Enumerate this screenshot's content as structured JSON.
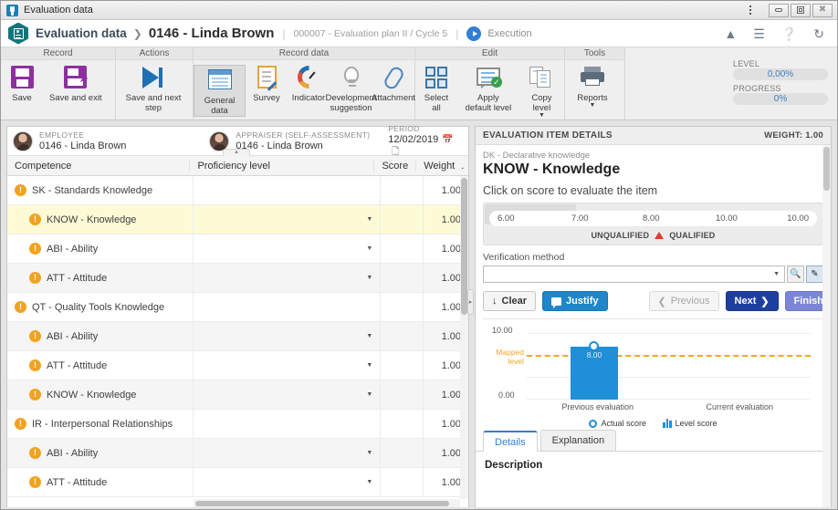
{
  "window": {
    "title": "Evaluation data",
    "icon": "app-icon",
    "buttons": {
      "menu": "⋮",
      "minimize": "minimize",
      "maximize": "maximize",
      "close": "close"
    }
  },
  "breadcrumb": {
    "icon": "evaluation-card-icon",
    "root": "Evaluation data",
    "separator": "❯",
    "current": "0146 - Linda Brown",
    "plan": "000007 - Evaluation plan II / Cycle 5",
    "status": "Execution",
    "tools": [
      "collapse-icon",
      "list-icon",
      "help-icon",
      "refresh-icon"
    ]
  },
  "ribbon": {
    "groups": [
      {
        "title": "Record",
        "buttons": [
          {
            "label": "Save",
            "icon": "save-icon"
          },
          {
            "label": "Save and exit",
            "icon": "save-and-exit-icon"
          }
        ]
      },
      {
        "title": "Actions",
        "buttons": [
          {
            "label": "Save and next step",
            "icon": "next-step-icon"
          }
        ]
      },
      {
        "title": "Record data",
        "buttons": [
          {
            "label": "General data",
            "icon": "general-data-icon",
            "selected": true
          },
          {
            "label": "Survey",
            "icon": "survey-icon"
          },
          {
            "label": "Indicator",
            "icon": "indicator-icon"
          },
          {
            "label": "Development suggestion",
            "icon": "bulb-icon"
          },
          {
            "label": "Attachment",
            "icon": "paperclip-icon"
          }
        ]
      },
      {
        "title": "Edit",
        "buttons": [
          {
            "label": "Select all",
            "icon": "select-all-icon"
          },
          {
            "label": "Apply default level",
            "icon": "apply-default-icon"
          },
          {
            "label": "Copy level",
            "icon": "copy-level-icon",
            "caret": "▼"
          }
        ]
      },
      {
        "title": "Tools",
        "buttons": [
          {
            "label": "Reports",
            "icon": "printer-icon",
            "caret": "▼"
          }
        ]
      }
    ],
    "status": {
      "level_label": "LEVEL",
      "level_value": "0,00%",
      "progress_label": "PROGRESS",
      "progress_value": "0%"
    }
  },
  "persons": {
    "employee_label": "EMPLOYEE",
    "employee_value": "0146 - Linda Brown",
    "appraiser_label": "APPRAISER (SELF-ASSESSMENT)",
    "appraiser_value": "0146 - Linda Brown",
    "period_label": "PERIOD",
    "period_value": "12/02/2019",
    "period_icons": [
      "calendar-icon",
      "note-icon"
    ]
  },
  "table": {
    "columns": [
      "Competence",
      "Proficiency level",
      "Score",
      "Weight",
      "."
    ],
    "rows": [
      {
        "competence": "SK - Standards Knowledge",
        "level": "",
        "score": "",
        "weight": "1.00",
        "indent": 1,
        "group": true,
        "selected": false,
        "alt": false,
        "dropdown": false
      },
      {
        "competence": "KNOW - Knowledge",
        "level": "",
        "score": "",
        "weight": "1.00",
        "indent": 2,
        "group": false,
        "selected": true,
        "alt": false,
        "dropdown": true
      },
      {
        "competence": "ABI - Ability",
        "level": "",
        "score": "",
        "weight": "1.00",
        "indent": 2,
        "group": false,
        "selected": false,
        "alt": false,
        "dropdown": true
      },
      {
        "competence": "ATT - Attitude",
        "level": "",
        "score": "",
        "weight": "1.00",
        "indent": 2,
        "group": false,
        "selected": false,
        "alt": true,
        "dropdown": true
      },
      {
        "competence": "QT - Quality Tools Knowledge",
        "level": "",
        "score": "",
        "weight": "1.00",
        "indent": 1,
        "group": true,
        "selected": false,
        "alt": false,
        "dropdown": false
      },
      {
        "competence": "ABI - Ability",
        "level": "",
        "score": "",
        "weight": "1.00",
        "indent": 2,
        "group": false,
        "selected": false,
        "alt": true,
        "dropdown": true
      },
      {
        "competence": "ATT - Attitude",
        "level": "",
        "score": "",
        "weight": "1.00",
        "indent": 2,
        "group": false,
        "selected": false,
        "alt": false,
        "dropdown": true
      },
      {
        "competence": "KNOW - Knowledge",
        "level": "",
        "score": "",
        "weight": "1.00",
        "indent": 2,
        "group": false,
        "selected": false,
        "alt": true,
        "dropdown": true
      },
      {
        "competence": "IR - Interpersonal Relationships",
        "level": "",
        "score": "",
        "weight": "1.00",
        "indent": 1,
        "group": true,
        "selected": false,
        "alt": false,
        "dropdown": false
      },
      {
        "competence": "ABI - Ability",
        "level": "",
        "score": "",
        "weight": "1.00",
        "indent": 2,
        "group": false,
        "selected": false,
        "alt": true,
        "dropdown": true
      },
      {
        "competence": "ATT - Attitude",
        "level": "",
        "score": "",
        "weight": "1.00",
        "indent": 2,
        "group": false,
        "selected": false,
        "alt": false,
        "dropdown": true
      }
    ]
  },
  "details": {
    "header": "EVALUATION ITEM DETAILS",
    "weight": "WEIGHT: 1.00",
    "category": "DK - Declarative knowledge",
    "title": "KNOW - Knowledge",
    "hint": "Click on score to evaluate the item",
    "scale_values": [
      "6.00",
      "7.00",
      "8.00",
      "10.00",
      "10.00"
    ],
    "legend_unqualified": "UNQUALIFIED",
    "legend_qualified": "QUALIFIED",
    "verification_label": "Verification method",
    "verification_value": "",
    "verification_icons": [
      "binoculars-icon",
      "brush-icon"
    ],
    "buttons": {
      "clear": "Clear",
      "justify": "Justify",
      "previous": "Previous",
      "next": "Next",
      "finish": "Finish"
    },
    "tabs": [
      {
        "label": "Details",
        "active": true
      },
      {
        "label": "Explanation",
        "active": false
      }
    ],
    "description_heading": "Description"
  },
  "chart_data": {
    "type": "bar",
    "title": "",
    "categories": [
      "Previous evaluation",
      "Current evaluation"
    ],
    "series": [
      {
        "name": "Level score",
        "values": [
          8.0,
          null
        ]
      },
      {
        "name": "Actual score",
        "values": [
          8.0,
          null
        ]
      }
    ],
    "values": [
      8.0,
      null
    ],
    "data_labels": [
      "8.00",
      ""
    ],
    "ylim": [
      0,
      10
    ],
    "ytick_labels": [
      "10.00",
      "0.00"
    ],
    "xlabel": "",
    "ylabel": "",
    "grid": true,
    "legend_position": "bottom",
    "legend": [
      "Actual score",
      "Level score"
    ],
    "annotations": [
      {
        "name": "mapped-level",
        "label": "Mapped level",
        "value": 8.0,
        "style": "dashed",
        "color": "#f5a623"
      }
    ],
    "colors": {
      "bar": "#1f8fd8",
      "marker": "#1f8fd8",
      "mapped_line": "#f5a623"
    }
  }
}
